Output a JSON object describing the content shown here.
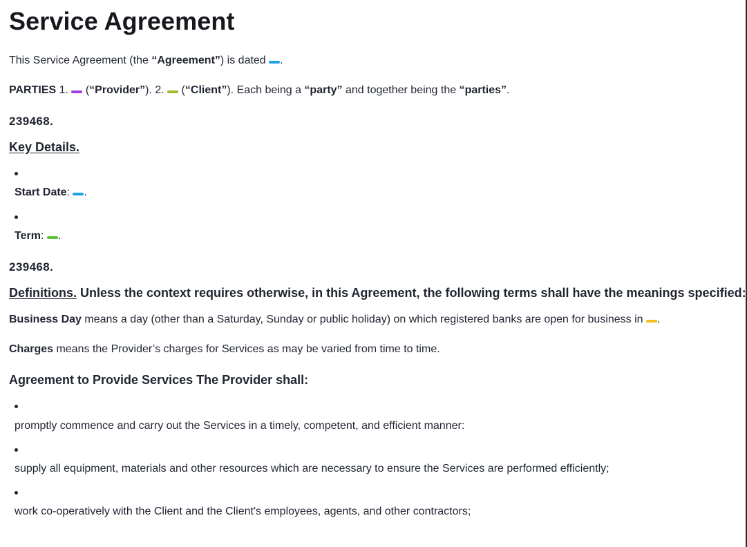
{
  "title": "Service Agreement",
  "intro": {
    "prefix": "This Service Agreement (the ",
    "term": "“Agreement”",
    "suffix": ") is dated ",
    "end": "."
  },
  "parties": {
    "label": "PARTIES",
    "n1": " 1. ",
    "provider_open": " (",
    "provider": "“Provider”",
    "provider_close": "). 2. ",
    "client_open": " (",
    "client": "“Client”",
    "mid": "). Each being a ",
    "party": "“party”",
    "and": " and together being the ",
    "parties_term": "“parties”",
    "end": "."
  },
  "section_number_1": "239468.",
  "key_details": {
    "heading": "Key Details.",
    "start_label": "Start Date",
    "start_colon": ": ",
    "start_end": ".",
    "term_label": "Term",
    "term_colon": ": ",
    "term_end": "."
  },
  "section_number_2": "239468.",
  "definitions": {
    "heading": "Definitions.",
    "heading_rest": " Unless the context requires otherwise, in this Agreement, the following terms shall have the meanings specified:",
    "business_day_term": "Business Day",
    "business_day_text": " means a day (other than a Saturday, Sunday or public holiday) on which registered banks are open for business in ",
    "business_day_end": ".",
    "charges_term": "Charges",
    "charges_text": " means the Provider’s charges for Services as may be varied from time to time."
  },
  "services": {
    "heading": "Agreement to Provide Services The Provider shall:",
    "items": [
      "promptly commence and carry out the Services in a timely, competent, and efficient manner:",
      "supply all equipment, materials and other resources which are necessary to ensure the Services are performed efficiently;",
      "work co-operatively with the Client and the Client's employees, agents, and other contractors;"
    ]
  },
  "placeholder_colors": {
    "date": "#1aa1e6",
    "provider": "#a23fe0",
    "client": "#a5b52c",
    "start_date": "#1aa1e6",
    "term": "#5ec23a",
    "business_day_location": "#f2c01c"
  }
}
